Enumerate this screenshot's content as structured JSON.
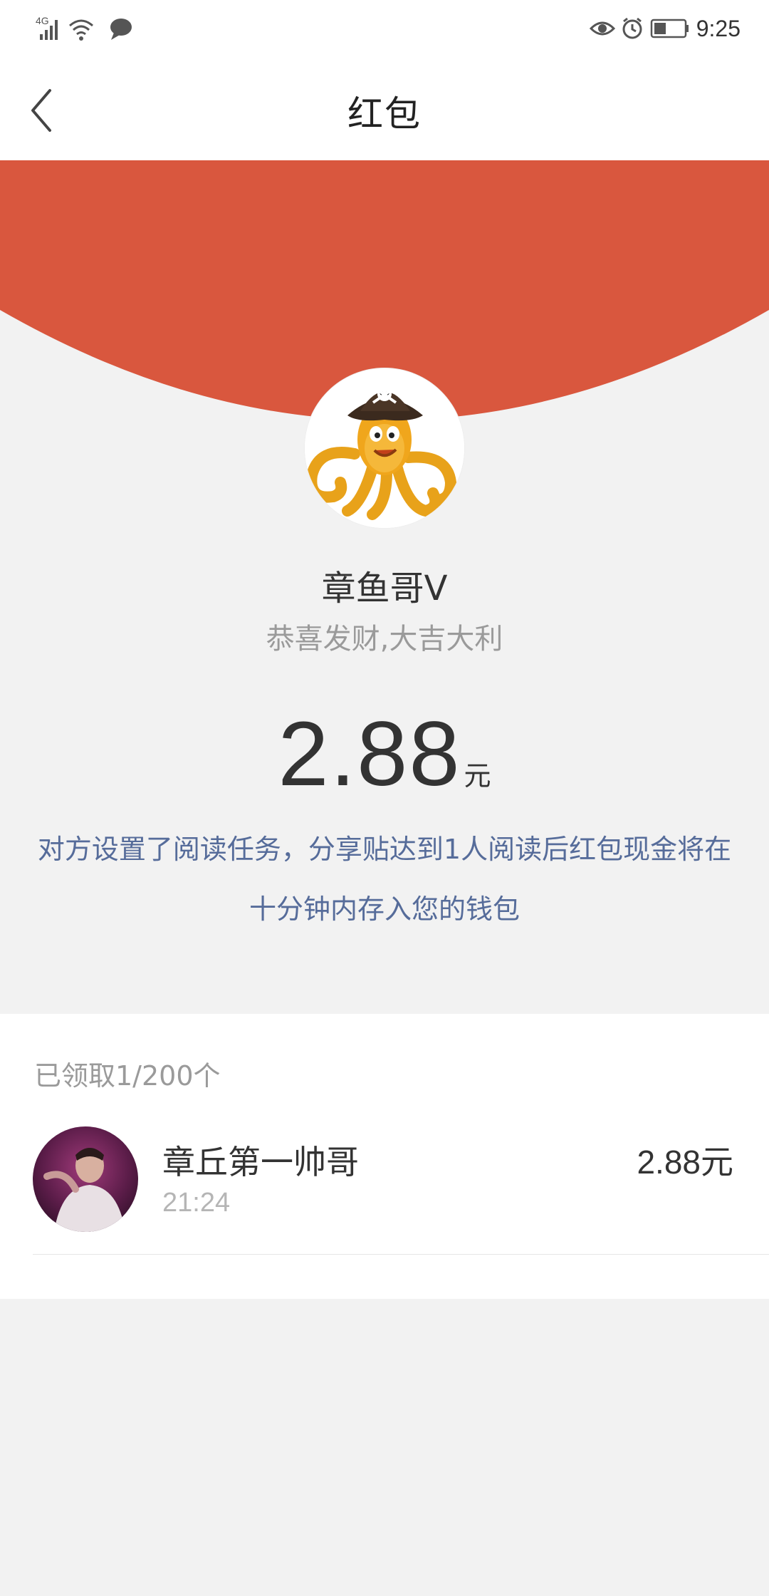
{
  "status_bar": {
    "network": "4G",
    "time": "9:25"
  },
  "header": {
    "title": "红包",
    "back_icon": "chevron-left-icon"
  },
  "colors": {
    "envelope_red": "#d9573e",
    "notice_blue": "#566c9a",
    "background": "#f2f2f2"
  },
  "sender": {
    "name": "章鱼哥V",
    "greeting": "恭喜发财,大吉大利",
    "avatar_icon": "pirate-octopus-avatar"
  },
  "amount": {
    "value": "2.88",
    "unit": "元"
  },
  "notice": {
    "line1": "对方设置了阅读任务，分享贴达到1人阅读后红包现金将在",
    "line2": "十分钟内存入您的钱包"
  },
  "receipts": {
    "count_text": "已领取1/200个",
    "items": [
      {
        "name": "章丘第一帅哥",
        "time": "21:24",
        "amount": "2.88元"
      }
    ]
  }
}
